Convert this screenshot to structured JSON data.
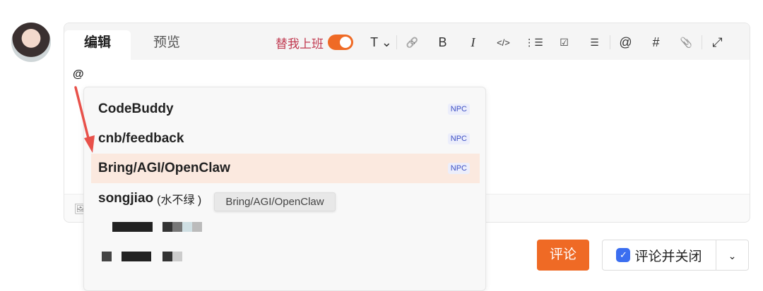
{
  "tabs": [
    {
      "label": "编辑"
    },
    {
      "label": "预览"
    }
  ],
  "toolbar": {
    "work_label": "替我上班",
    "work_toggle_on": true,
    "icons": [
      "text-style-icon",
      "link-icon",
      "bold-icon",
      "italic-icon",
      "code-icon",
      "ordered-list-icon",
      "task-list-icon",
      "bullet-list-icon",
      "mention-icon",
      "hashtag-icon",
      "attachment-icon",
      "fullscreen-icon"
    ],
    "glyphs": {
      "text": "T ⌄",
      "link": "🔗",
      "bold": "B",
      "italic": "I",
      "code": "</>",
      "ol": "⋮☰",
      "task": "☑",
      "ul": "☰",
      "at": "@",
      "hash": "#",
      "clip": "📎",
      "expand": "⤢"
    }
  },
  "editor": {
    "value": "@",
    "image_icon": "🖼"
  },
  "mentions": [
    {
      "name": "CodeBuddy",
      "badge": "NPC"
    },
    {
      "name": "cnb/feedback",
      "badge": "NPC"
    },
    {
      "name": "Bring/AGI/OpenClaw",
      "badge": "NPC",
      "highlighted": true
    },
    {
      "name": "songjiao",
      "sub": "(水不绿 )"
    }
  ],
  "tooltip": "Bring/AGI/OpenClaw",
  "buttons": {
    "comment": "评论",
    "comment_close": "评论并关闭",
    "check": "✓",
    "more": "⌄"
  }
}
